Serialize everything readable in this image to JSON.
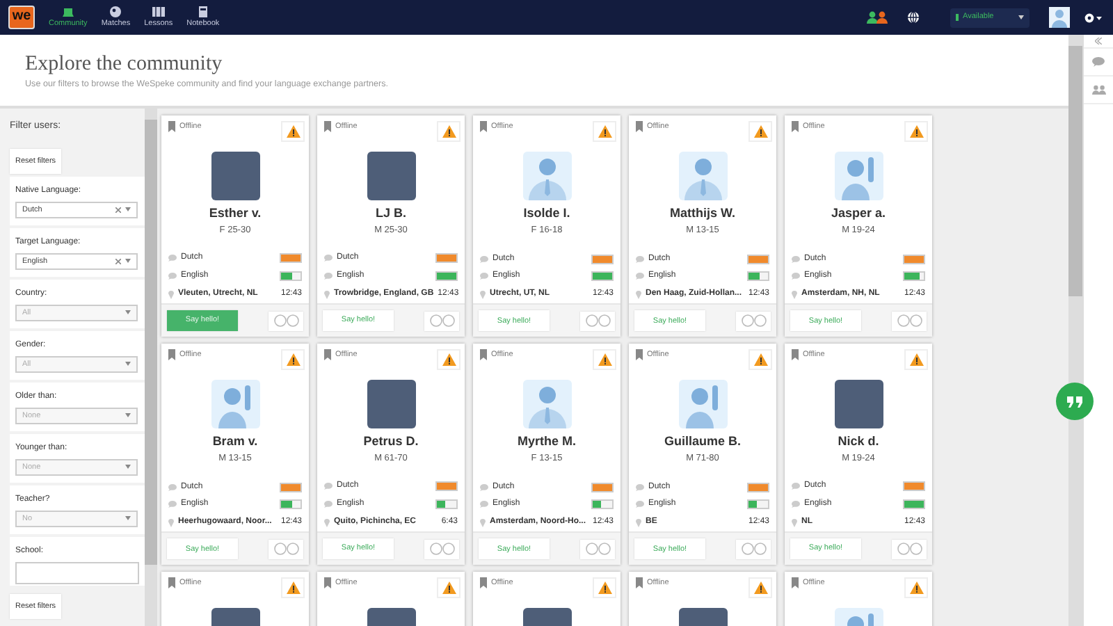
{
  "navbar": {
    "logo": "we",
    "nav_items": [
      {
        "label": "Community",
        "selected": true
      },
      {
        "label": "Matches",
        "selected": false
      },
      {
        "label": "Lessons",
        "selected": false
      },
      {
        "label": "Notebook",
        "selected": false
      }
    ],
    "status": {
      "value": "Available"
    }
  },
  "header": {
    "title": "Explore the community",
    "subtitle": "Use our filters to browse the WeSpeke community and find your language exchange partners."
  },
  "filters": {
    "heading": "Filter users:",
    "reset_top": "Reset filters",
    "fields": [
      {
        "label": "Native Language:",
        "kind": "select",
        "value": "Dutch",
        "clearable": true
      },
      {
        "label": "Target Language:",
        "kind": "select",
        "value": "English",
        "clearable": true
      },
      {
        "label": "Country:",
        "kind": "select",
        "placeholder": "All",
        "clearable": false
      },
      {
        "label": "Gender:",
        "kind": "select",
        "placeholder": "All",
        "clearable": false
      },
      {
        "label": "Older than:",
        "kind": "select",
        "placeholder": "None",
        "clearable": false
      },
      {
        "label": "Younger than:",
        "kind": "select",
        "placeholder": "None",
        "clearable": false
      },
      {
        "label": "Teacher?",
        "kind": "select",
        "placeholder": "No",
        "clearable": false
      },
      {
        "label": "School:",
        "kind": "text"
      }
    ],
    "reset_bottom": "Reset filters"
  },
  "cards": [
    {
      "status": "Offline",
      "avatar": {
        "kind": "photo"
      },
      "name": "Esther v.",
      "details": "F 25-30",
      "languages": [
        {
          "name": "Dutch",
          "kind": "native",
          "level": 1
        },
        {
          "name": "English",
          "kind": "target",
          "level": 0.6
        }
      ],
      "location": "Vleuten, Utrecht, NL",
      "time": "12:43",
      "button": "Say hello!",
      "button_active": true
    },
    {
      "status": "Offline",
      "avatar": {
        "kind": "photo"
      },
      "name": "LJ B.",
      "details": "M 25-30",
      "languages": [
        {
          "name": "Dutch",
          "kind": "native",
          "level": 1
        },
        {
          "name": "English",
          "kind": "target",
          "level": 1
        }
      ],
      "location": "Trowbridge, England, GB",
      "time": "12:43",
      "button": "Say hello!",
      "button_active": false
    },
    {
      "status": "Offline",
      "avatar": {
        "kind": "tie"
      },
      "name": "Isolde I.",
      "details": "F 16-18",
      "languages": [
        {
          "name": "Dutch",
          "kind": "native",
          "level": 1
        },
        {
          "name": "English",
          "kind": "target",
          "level": 1
        }
      ],
      "location": "Utrecht, UT, NL",
      "time": "12:43",
      "button": "Say hello!",
      "button_active": false
    },
    {
      "status": "Offline",
      "avatar": {
        "kind": "tie"
      },
      "name": "Matthijs W.",
      "details": "M 13-15",
      "languages": [
        {
          "name": "Dutch",
          "kind": "native",
          "level": 1
        },
        {
          "name": "English",
          "kind": "target",
          "level": 0.6
        }
      ],
      "location": "Den Haag, Zuid-Hollan...",
      "time": "12:43",
      "button": "Say hello!",
      "button_active": false
    },
    {
      "status": "Offline",
      "avatar": {
        "kind": "wave"
      },
      "name": "Jasper a.",
      "details": "M 19-24",
      "languages": [
        {
          "name": "Dutch",
          "kind": "native",
          "level": 1
        },
        {
          "name": "English",
          "kind": "target",
          "level": 0.8
        }
      ],
      "location": "Amsterdam, NH, NL",
      "time": "12:43",
      "button": "Say hello!",
      "button_active": false
    },
    {
      "status": "Offline",
      "avatar": {
        "kind": "wave"
      },
      "name": "Bram v.",
      "details": "M 13-15",
      "languages": [
        {
          "name": "Dutch",
          "kind": "native",
          "level": 1
        },
        {
          "name": "English",
          "kind": "target",
          "level": 0.6
        }
      ],
      "location": "Heerhugowaard, Noor...",
      "time": "12:43",
      "button": "Say hello!",
      "button_active": false
    },
    {
      "status": "Offline",
      "avatar": {
        "kind": "photo"
      },
      "name": "Petrus D.",
      "details": "M 61-70",
      "languages": [
        {
          "name": "Dutch",
          "kind": "native",
          "level": 1
        },
        {
          "name": "English",
          "kind": "target",
          "level": 0.4
        }
      ],
      "location": "Quito, Pichincha, EC",
      "time": "6:43",
      "button": "Say hello!",
      "button_active": false
    },
    {
      "status": "Offline",
      "avatar": {
        "kind": "tie"
      },
      "name": "Myrthe M.",
      "details": "F 13-15",
      "languages": [
        {
          "name": "Dutch",
          "kind": "native",
          "level": 1
        },
        {
          "name": "English",
          "kind": "target",
          "level": 0.4
        }
      ],
      "location": "Amsterdam, Noord-Ho...",
      "time": "12:43",
      "button": "Say hello!",
      "button_active": false
    },
    {
      "status": "Offline",
      "avatar": {
        "kind": "wave"
      },
      "name": "Guillaume B.",
      "details": "M 71-80",
      "languages": [
        {
          "name": "Dutch",
          "kind": "native",
          "level": 1
        },
        {
          "name": "English",
          "kind": "target",
          "level": 0.4
        }
      ],
      "location": "BE",
      "time": "12:43",
      "button": "Say hello!",
      "button_active": false
    },
    {
      "status": "Offline",
      "avatar": {
        "kind": "photo"
      },
      "name": "Nick d.",
      "details": "M 19-24",
      "languages": [
        {
          "name": "Dutch",
          "kind": "native",
          "level": 1
        },
        {
          "name": "English",
          "kind": "target",
          "level": 1
        }
      ],
      "location": "NL",
      "time": "12:43",
      "button": "Say hello!",
      "button_active": false
    },
    {
      "status": "Offline",
      "avatar": {
        "kind": "photo"
      }
    },
    {
      "status": "Offline",
      "avatar": {
        "kind": "photo"
      }
    },
    {
      "status": "Offline",
      "avatar": {
        "kind": "photo"
      }
    },
    {
      "status": "Offline",
      "avatar": {
        "kind": "photo"
      }
    },
    {
      "status": "Offline",
      "avatar": {
        "kind": "wave"
      }
    }
  ]
}
